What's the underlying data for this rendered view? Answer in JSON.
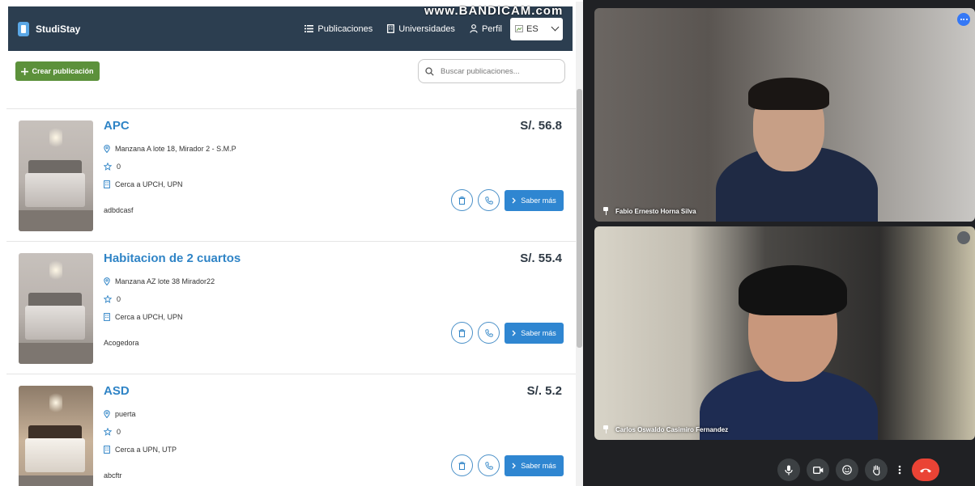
{
  "watermark": "www.BANDICAM.com",
  "nav": {
    "brand": "StudiStay",
    "links": [
      "Publicaciones",
      "Universidades",
      "Perfil"
    ],
    "lang": "ES"
  },
  "toolbar": {
    "create_label": "Crear publicación",
    "search_placeholder": "Buscar publicaciones..."
  },
  "listings": [
    {
      "title": "APC",
      "price": "S/. 56.8",
      "address": "Manzana A lote 18, Mirador 2 - S.M.P",
      "rating": "0",
      "near": "Cerca a UPCH, UPN",
      "description": "adbdcasf",
      "more_label": "Saber más"
    },
    {
      "title": "Habitacion de 2 cuartos",
      "price": "S/. 55.4",
      "address": "Manzana AZ lote 38 Mirador22",
      "rating": "0",
      "near": "Cerca a UPCH, UPN",
      "description": "Acogedora",
      "more_label": "Saber más"
    },
    {
      "title": "ASD",
      "price": "S/. 5.2",
      "address": "puerta",
      "rating": "0",
      "near": "Cerca a UPN, UTP",
      "description": "abcftr",
      "more_label": "Saber más"
    }
  ],
  "meet": {
    "participants": [
      {
        "name": "Fabio Ernesto Horna Silva"
      },
      {
        "name": "Carlos Oswaldo Casimiro Fernandez"
      }
    ]
  },
  "colors": {
    "navbar": "#2c3e50",
    "accent_blue": "#2f86d1",
    "create_green": "#5c913b",
    "end_call_red": "#ea4335"
  }
}
